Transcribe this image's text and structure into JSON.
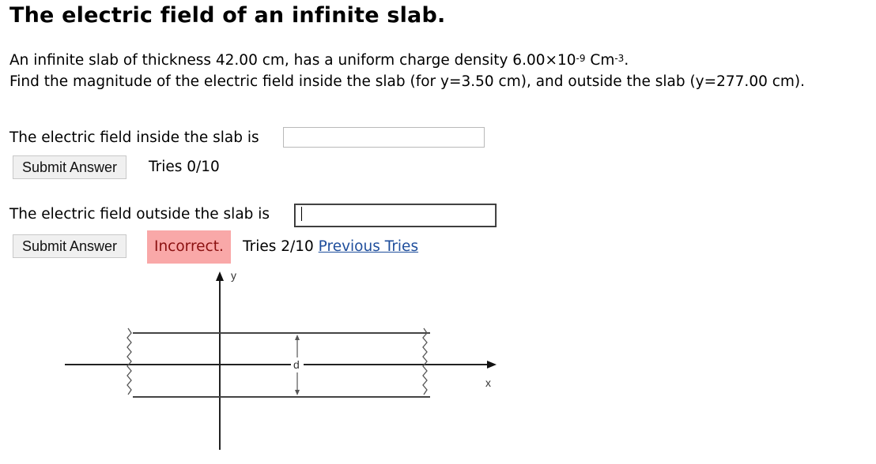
{
  "title": "The electric field of an infinite slab.",
  "problem": {
    "line1_prefix": "An infinite slab of thickness 42.00 cm, has a uniform charge density 6.00×10",
    "line1_exp": "-9",
    "line1_unit": " Cm",
    "line1_unit_exp": "-3",
    "line1_end": ".",
    "line2": "Find the magnitude of the electric field inside the slab (for y=3.50 cm), and outside the slab (y=277.00 cm)."
  },
  "questions": [
    {
      "label": "The electric field inside the slab is",
      "value": "",
      "submit_label": "Submit Answer",
      "status": "",
      "tries": "Tries 0/10",
      "link": ""
    },
    {
      "label": "The electric field outside the slab is",
      "value": "",
      "submit_label": "Submit Answer",
      "status": "Incorrect.",
      "tries": "Tries 2/10",
      "link": "Previous Tries"
    }
  ],
  "diagram": {
    "y_axis_label": "y",
    "x_axis_label": "x",
    "thickness_label": "d"
  },
  "colors": {
    "incorrect_bg": "#f9a8a8",
    "incorrect_text": "#8b1010",
    "link": "#1f4e9c"
  }
}
